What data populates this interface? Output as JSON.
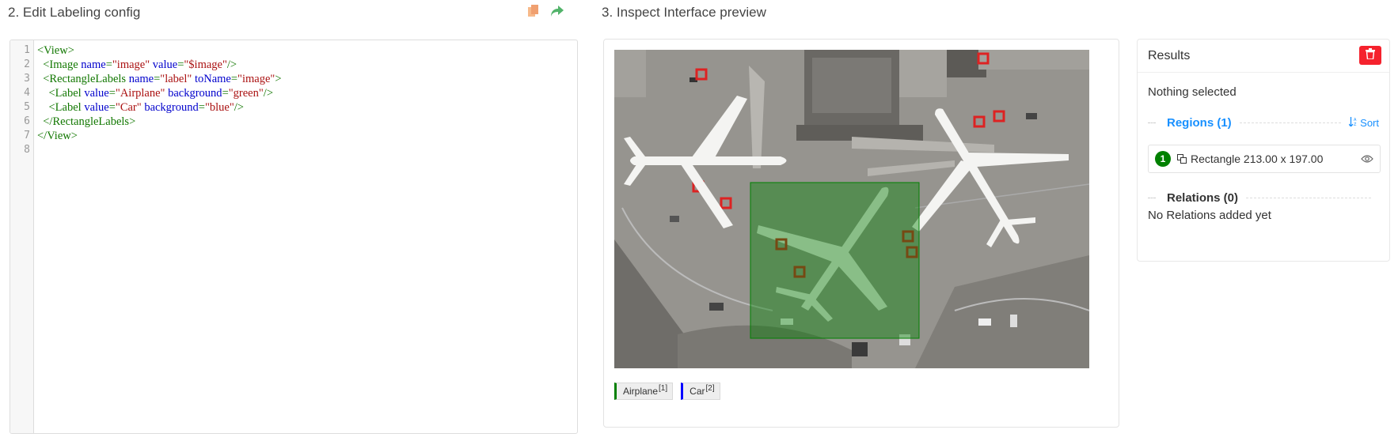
{
  "config_section": {
    "title": "2. Edit Labeling config",
    "icons": [
      "copy-icon",
      "share-icon"
    ],
    "code_lines": [
      [
        {
          "c": "t",
          "v": "<View>"
        }
      ],
      [
        {
          "c": "",
          "v": "  "
        },
        {
          "c": "t",
          "v": "<Image "
        },
        {
          "c": "a",
          "v": "name"
        },
        {
          "c": "t",
          "v": "="
        },
        {
          "c": "s",
          "v": "\"image\""
        },
        {
          "c": "",
          "v": " "
        },
        {
          "c": "a",
          "v": "value"
        },
        {
          "c": "t",
          "v": "="
        },
        {
          "c": "s",
          "v": "\"$image\""
        },
        {
          "c": "t",
          "v": "/>"
        }
      ],
      [
        {
          "c": "",
          "v": "  "
        },
        {
          "c": "t",
          "v": "<RectangleLabels "
        },
        {
          "c": "a",
          "v": "name"
        },
        {
          "c": "t",
          "v": "="
        },
        {
          "c": "s",
          "v": "\"label\""
        },
        {
          "c": "",
          "v": " "
        },
        {
          "c": "a",
          "v": "toName"
        },
        {
          "c": "t",
          "v": "="
        },
        {
          "c": "s",
          "v": "\"image\""
        },
        {
          "c": "t",
          "v": ">"
        }
      ],
      [
        {
          "c": "",
          "v": "    "
        },
        {
          "c": "t",
          "v": "<Label "
        },
        {
          "c": "a",
          "v": "value"
        },
        {
          "c": "t",
          "v": "="
        },
        {
          "c": "s",
          "v": "\"Airplane\""
        },
        {
          "c": "",
          "v": " "
        },
        {
          "c": "a",
          "v": "background"
        },
        {
          "c": "t",
          "v": "="
        },
        {
          "c": "s",
          "v": "\"green\""
        },
        {
          "c": "t",
          "v": "/>"
        }
      ],
      [
        {
          "c": "",
          "v": "    "
        },
        {
          "c": "t",
          "v": "<Label "
        },
        {
          "c": "a",
          "v": "value"
        },
        {
          "c": "t",
          "v": "="
        },
        {
          "c": "s",
          "v": "\"Car\""
        },
        {
          "c": "",
          "v": " "
        },
        {
          "c": "a",
          "v": "background"
        },
        {
          "c": "t",
          "v": "="
        },
        {
          "c": "s",
          "v": "\"blue\""
        },
        {
          "c": "t",
          "v": "/>"
        }
      ],
      [
        {
          "c": "",
          "v": "  "
        },
        {
          "c": "t",
          "v": "</RectangleLabels>"
        }
      ],
      [
        {
          "c": "t",
          "v": "</View>"
        }
      ],
      []
    ],
    "line_numbers": [
      "1",
      "2",
      "3",
      "4",
      "5",
      "6",
      "7",
      "8"
    ]
  },
  "preview_section": {
    "title": "3. Inspect Interface preview",
    "labels": [
      {
        "name": "Airplane",
        "hotkey": "[1]",
        "color": "#008000"
      },
      {
        "name": "Car",
        "hotkey": "[2]",
        "color": "#0000ff"
      }
    ],
    "region_color": "#008000"
  },
  "results": {
    "title": "Results",
    "nothing_selected": "Nothing selected",
    "regions_label": "Regions (1)",
    "sort_label": "Sort",
    "region_items": [
      {
        "index": "1",
        "text": "Rectangle 213.00 x 197.00"
      }
    ],
    "relations_label": "Relations (0)",
    "no_relations": "No Relations added yet",
    "delete_color": "#f5222d"
  }
}
